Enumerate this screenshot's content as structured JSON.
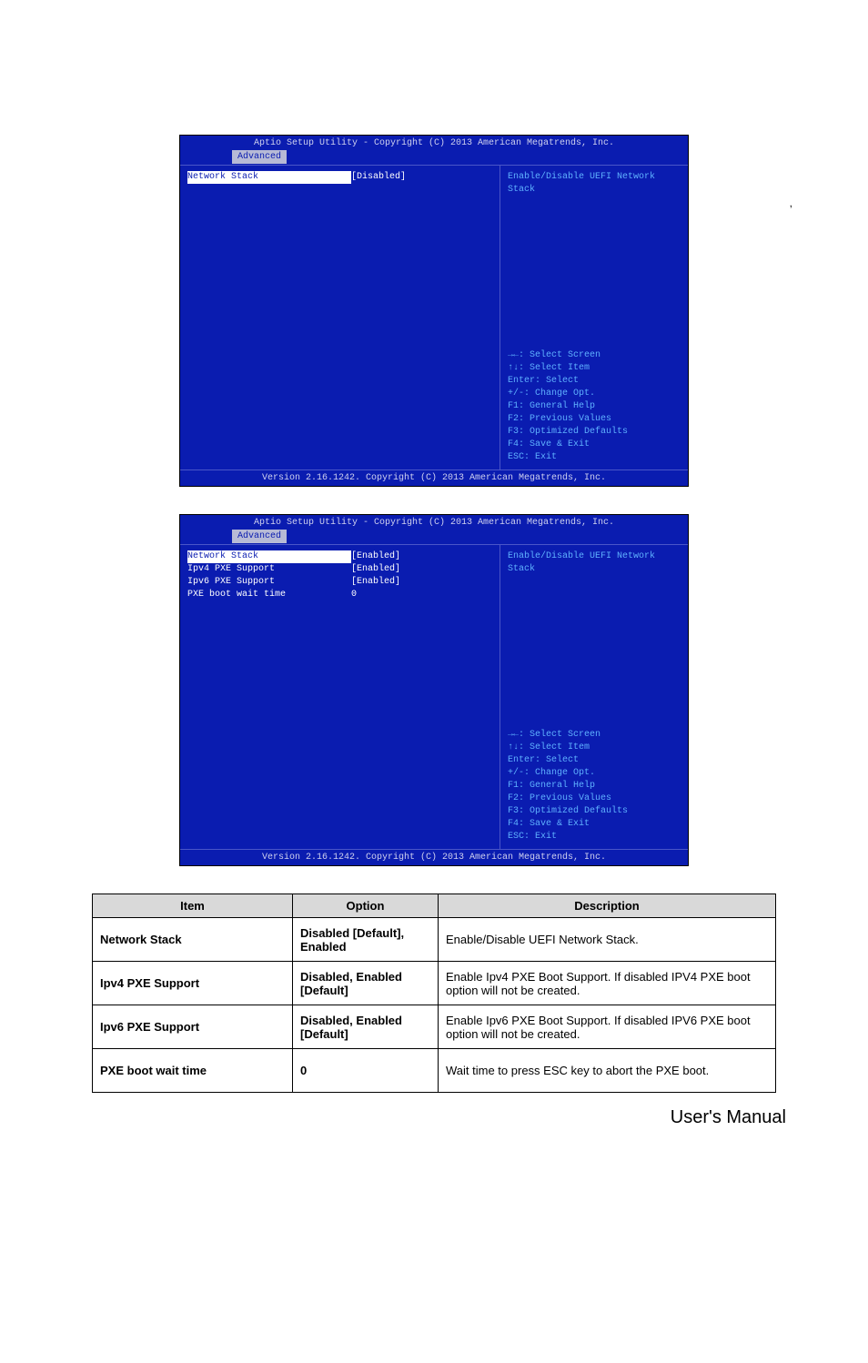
{
  "page_header_right": ",",
  "bios1": {
    "title": "Aptio Setup Utility - Copyright (C) 2013 American Megatrends, Inc.",
    "tab": "Advanced",
    "rows": [
      {
        "label": "Network Stack",
        "value": "[Disabled]",
        "selected": true
      }
    ],
    "help": "Enable/Disable UEFI Network Stack",
    "keys": [
      "→←: Select Screen",
      "↑↓: Select Item",
      "Enter: Select",
      "+/-: Change Opt.",
      "F1: General Help",
      "F2: Previous Values",
      "F3: Optimized Defaults",
      "F4: Save & Exit",
      "ESC: Exit"
    ],
    "footer": "Version 2.16.1242. Copyright (C) 2013 American Megatrends, Inc."
  },
  "bios2": {
    "title": "Aptio Setup Utility - Copyright (C) 2013 American Megatrends, Inc.",
    "tab": "Advanced",
    "rows": [
      {
        "label": "Network Stack",
        "value": "[Enabled]",
        "selected": true
      },
      {
        "label": "Ipv4 PXE Support",
        "value": "[Enabled]"
      },
      {
        "label": "Ipv6 PXE Support",
        "value": "[Enabled]"
      },
      {
        "label": "PXE boot wait time",
        "value": "0"
      }
    ],
    "help": "Enable/Disable UEFI Network Stack",
    "keys": [
      "→←: Select Screen",
      "↑↓: Select Item",
      "Enter: Select",
      "+/-: Change Opt.",
      "F1: General Help",
      "F2: Previous Values",
      "F3: Optimized Defaults",
      "F4: Save & Exit",
      "ESC: Exit"
    ],
    "footer": "Version 2.16.1242. Copyright (C) 2013 American Megatrends, Inc."
  },
  "table": {
    "headers": [
      "Item",
      "Option",
      "Description"
    ],
    "rows": [
      {
        "item": "Network Stack",
        "option": "Disabled [Default],\nEnabled",
        "desc": "Enable/Disable UEFI Network Stack."
      },
      {
        "item": "Ipv4 PXE Support",
        "option": "Disabled,\nEnabled [Default]",
        "desc": "Enable Ipv4 PXE Boot Support. If disabled IPV4 PXE boot option will not be created."
      },
      {
        "item": "Ipv6 PXE Support",
        "option": "Disabled,\nEnabled [Default]",
        "desc": "Enable Ipv6 PXE Boot Support. If disabled IPV6 PXE boot option will not be created."
      },
      {
        "item": "PXE boot wait time",
        "option": "0",
        "desc": "Wait time to press ESC key to abort the PXE boot."
      }
    ]
  },
  "footer": "User's  Manual"
}
